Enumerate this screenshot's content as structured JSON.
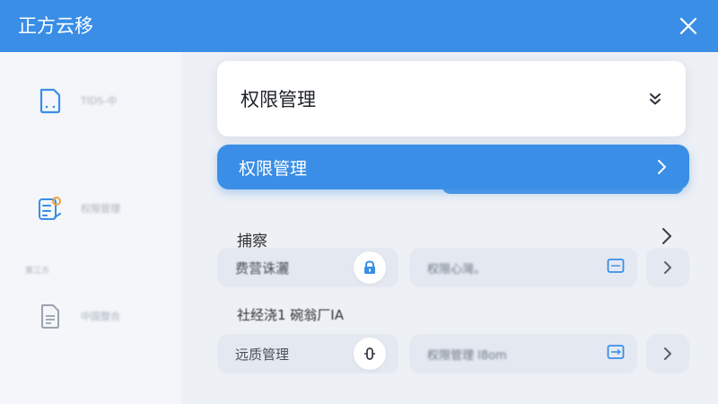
{
  "app": {
    "title": "正方云移"
  },
  "sidebar": {
    "items": [
      {
        "label": "TIDS-中",
        "icon": "document-scan-icon"
      },
      {
        "label": "权限管理",
        "icon": "settings-list-icon"
      },
      {
        "label": "中国整合",
        "icon": "file-text-icon"
      }
    ],
    "section_label": "第三方"
  },
  "main": {
    "dropdown": {
      "title": "权限管理",
      "icon": "double-chevron-down-icon"
    },
    "primary_row": {
      "label": "权限管理",
      "icon": "chevron-right-icon"
    },
    "section": {
      "title": "捕察"
    },
    "row1": {
      "left_text": "费营诛灑",
      "left_icon": "lock-icon",
      "right_text": "权限心灣。",
      "right_icon": "image-icon"
    },
    "row_label": "社经浇1 碗翁厂IA",
    "row2": {
      "left_text": "远质管理",
      "left_icon": "toggle-icon",
      "right_text": "权限管理 l8om",
      "right_icon": "expand-icon"
    }
  },
  "colors": {
    "primary": "#3a8ee6",
    "background": "#eef1f6",
    "sidebar": "#f4f6f9",
    "pill": "#e4e9f1"
  }
}
